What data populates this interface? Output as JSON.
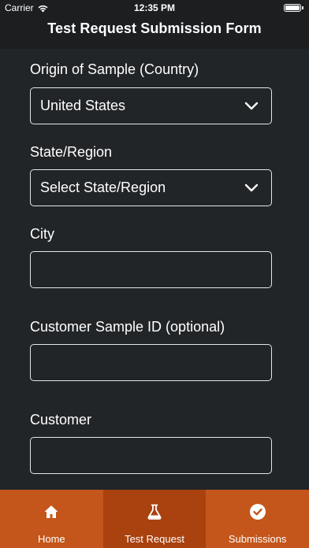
{
  "status_bar": {
    "carrier": "Carrier",
    "time": "12:35 PM",
    "icons": [
      "wifi-icon",
      "battery-icon"
    ]
  },
  "header": {
    "title": "Test Request Submission Form"
  },
  "form": {
    "origin_country": {
      "label": "Origin of Sample (Country)",
      "value": "United States"
    },
    "state_region": {
      "label": "State/Region",
      "value": "Select State/Region"
    },
    "city": {
      "label": "City",
      "value": ""
    },
    "customer_sample_id": {
      "label": "Customer Sample ID (optional)",
      "value": ""
    },
    "customer": {
      "label": "Customer",
      "value": ""
    }
  },
  "tab_bar": {
    "tabs": [
      {
        "label": "Home",
        "icon": "home-icon",
        "active": false
      },
      {
        "label": "Test Request",
        "icon": "flask-icon",
        "active": true
      },
      {
        "label": "Submissions",
        "icon": "check-circle-icon",
        "active": false
      }
    ]
  },
  "colors": {
    "background": "#222528",
    "tab_bar": "#c4561b",
    "tab_active": "#a9420f",
    "text": "#ffffff"
  }
}
